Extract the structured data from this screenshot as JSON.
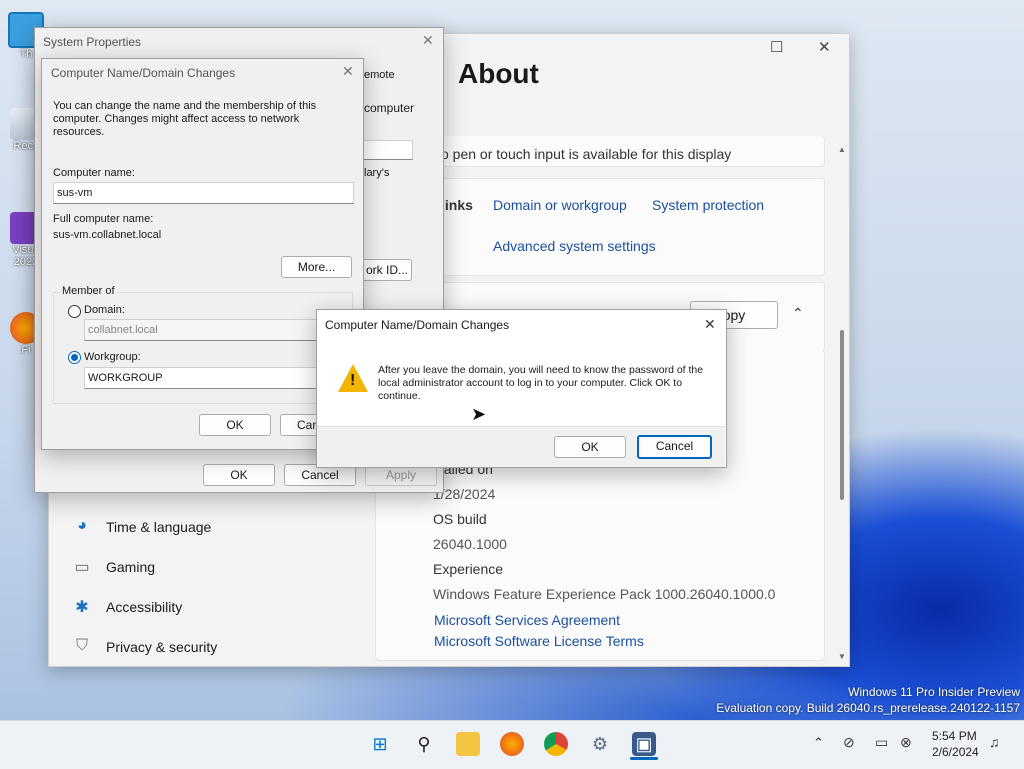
{
  "desktop": {
    "icons": [
      {
        "label": "Th"
      },
      {
        "label": "Recy"
      },
      {
        "label": "Visua"
      },
      {
        "label": "2022"
      },
      {
        "label": "Fi"
      }
    ],
    "watermark": {
      "line1": "Windows 11 Pro Insider Preview",
      "line2": "Evaluation copy. Build 26040.rs_prerelease.240122-1157"
    }
  },
  "settings": {
    "breadcrumb_prefix": "m",
    "breadcrumb_sep": "›",
    "title": "About",
    "pen_text": "o pen or touch input is available for this display",
    "related_links_label": "links",
    "links": {
      "domain": "Domain or workgroup",
      "protection": "System protection",
      "advanced": "Advanced system settings"
    },
    "copy_button": "opy",
    "installed_on_label": "stalled on",
    "installed_on_value": "1/28/2024",
    "os_build_label": "OS build",
    "os_build_value": "26040.1000",
    "experience_label": "Experience",
    "experience_value": "Windows Feature Experience Pack 1000.26040.1000.0",
    "msa_link": "Microsoft Services Agreement",
    "mslt_link": "Microsoft Software License Terms",
    "nav": [
      {
        "label": "Time & language",
        "icon": "globe-clock-icon"
      },
      {
        "label": "Gaming",
        "icon": "gamepad-icon"
      },
      {
        "label": "Accessibility",
        "icon": "accessibility-icon"
      },
      {
        "label": "Privacy & security",
        "icon": "shield-icon"
      }
    ]
  },
  "system_properties": {
    "title": "System Properties",
    "tab_remote": "emote",
    "computer_text": "computer",
    "ary_text": "lary's",
    "network_id_button": "ork ID...",
    "ok": "OK",
    "cancel": "Cancel",
    "apply": "Apply"
  },
  "domain_changes": {
    "title": "Computer Name/Domain Changes",
    "intro": "You can change the name and the membership of this computer. Changes might affect access to network resources.",
    "computer_name_label": "Computer name:",
    "computer_name_value": "sus-vm",
    "full_name_label": "Full computer name:",
    "full_name_value": "sus-vm.collabnet.local",
    "more_button": "More...",
    "member_of_label": "Member of",
    "domain_label": "Domain:",
    "domain_value": "collabnet.local",
    "workgroup_label": "Workgroup:",
    "workgroup_value": "WORKGROUP",
    "ok": "OK",
    "cancel": "Can"
  },
  "alert": {
    "title": "Computer Name/Domain Changes",
    "message": "After you leave the domain, you will need to know the password of the local administrator account to log in to your computer. Click OK to continue.",
    "ok": "OK",
    "cancel": "Cancel"
  },
  "taskbar": {
    "time": "5:54 PM",
    "date": "2/6/2024"
  },
  "colors": {
    "accent": "#0067c0",
    "link": "#1a4f9e",
    "warning": "#f2b600"
  }
}
